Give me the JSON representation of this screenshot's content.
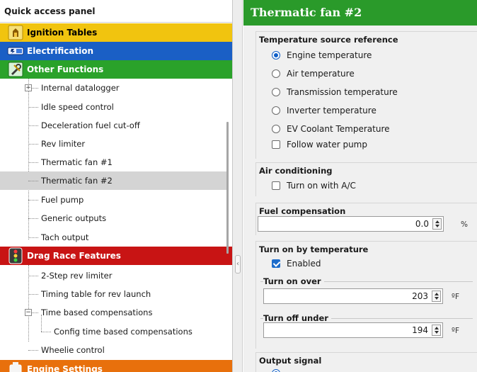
{
  "left_panel": {
    "title": "Quick access panel",
    "categories": {
      "ignition": "Ignition Tables",
      "electrification": "Electrification",
      "other": "Other Functions",
      "drag": "Drag Race Features",
      "engine": "Engine Settings"
    },
    "other_items": [
      "Internal datalogger",
      "Idle speed control",
      "Deceleration fuel cut-off",
      "Rev limiter",
      "Thermatic fan #1",
      "Thermatic fan #2",
      "Fuel pump",
      "Generic outputs",
      "Tach output"
    ],
    "drag_items": [
      "2-Step rev limiter",
      "Timing table for rev launch",
      "Time based compensations",
      "Config time based compensations",
      "Wheelie control"
    ],
    "selected_item": "Thermatic fan #2"
  },
  "right_panel": {
    "title": "Thermatic fan #2",
    "temperature_source": {
      "title": "Temperature source reference",
      "options": [
        "Engine temperature",
        "Air temperature",
        "Transmission temperature",
        "Inverter temperature",
        "EV Coolant Temperature"
      ],
      "selected": "Engine temperature",
      "follow_water_pump": "Follow water pump",
      "follow_water_pump_checked": false
    },
    "air_conditioning": {
      "title": "Air conditioning",
      "turn_on_ac": "Turn on with A/C",
      "turn_on_ac_checked": false
    },
    "fuel_compensation": {
      "title": "Fuel compensation",
      "value": "0.0",
      "unit": "%"
    },
    "turn_on_by_temperature": {
      "title": "Turn on by temperature",
      "enabled_label": "Enabled",
      "enabled_checked": true,
      "turn_on_over": {
        "label": "Turn on over",
        "value": "203",
        "unit": "ºF"
      },
      "turn_off_under": {
        "label": "Turn off under",
        "value": "194",
        "unit": "ºF"
      }
    },
    "output_signal": {
      "title": "Output signal"
    }
  },
  "colors": {
    "ignition": "#f1c40f",
    "electrification": "#1a5fc5",
    "other": "#2aa22a",
    "drag": "#c81414",
    "engine": "#e8700c",
    "header": "#2a9a2a",
    "selection": "#d4d4d4",
    "accent": "#0f5ec7"
  }
}
